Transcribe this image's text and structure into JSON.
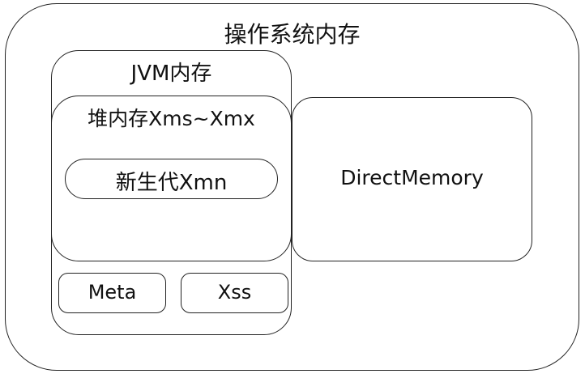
{
  "diagram": {
    "os_memory": {
      "label": "操作系统内存"
    },
    "jvm_memory": {
      "label": "JVM内存"
    },
    "heap": {
      "label": "堆内存Xms~Xmx"
    },
    "young_generation": {
      "label": "新生代Xmn"
    },
    "meta": {
      "label": "Meta"
    },
    "xss": {
      "label": "Xss"
    },
    "direct_memory": {
      "label": "DirectMemory"
    }
  }
}
